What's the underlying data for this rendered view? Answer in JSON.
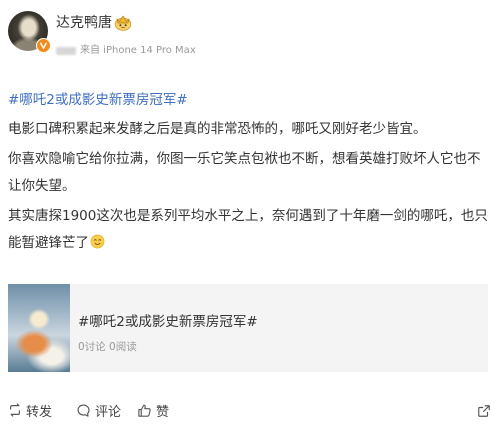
{
  "user": {
    "name": "达克鸭唐",
    "source": "来自 iPhone 14 Pro Max"
  },
  "post": {
    "hashtag": "#哪吒2或成影史新票房冠军#",
    "paragraphs": [
      [
        "电影口碑积累起来发酵之后是真的非常恐怖的，哪吒又刚好老少皆宜。"
      ],
      [
        "你喜欢隐喻它给你拉满，你图一乐它笑点包袱也不断，想看英雄打败坏人它也不",
        "让你失望。"
      ],
      [
        "其实唐探1900这次也是系列平均水平之上，奈何遇到了十年磨一剑的哪吒，也只",
        "能暂避锋芒了"
      ]
    ]
  },
  "topic_card": {
    "title": "#哪吒2或成影史新票房冠军#",
    "stats": "0讨论 0阅读"
  },
  "actions": {
    "repost": "转发",
    "comment": "评论",
    "like": "赞"
  },
  "icons": {
    "avatar_badge": "verified-badge-icon",
    "member": "member-badge-icon",
    "emoji": "emoji-face-icon",
    "repost": "repost-icon",
    "comment": "comment-icon",
    "like": "thumbs-up-icon",
    "share": "share-icon"
  },
  "colors": {
    "text": "#333333",
    "meta": "#999999",
    "link": "#3f6fc0",
    "card_background": "#f4f4f4",
    "verified_badge": "#f28c1f"
  }
}
